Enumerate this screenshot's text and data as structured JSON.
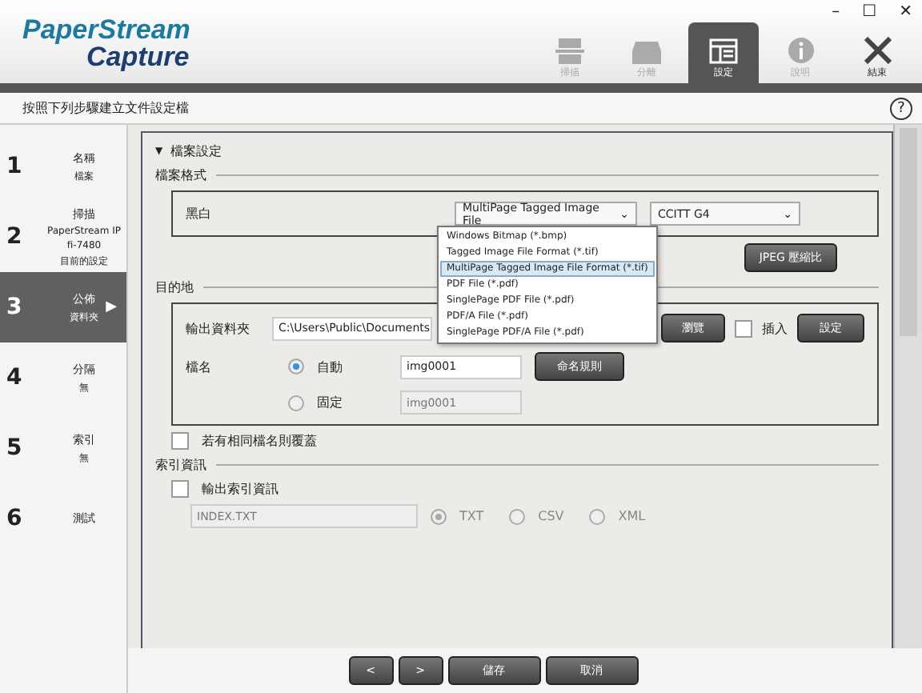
{
  "window_controls": [
    "–",
    "☐",
    "✕"
  ],
  "product": {
    "line1": "PaperStream",
    "line2": "Capture"
  },
  "toolbar": [
    {
      "label": "掃描",
      "selected": false,
      "disabled": true,
      "kind": "scan"
    },
    {
      "label": "分離",
      "selected": false,
      "disabled": true,
      "kind": "tray"
    },
    {
      "label": "設定",
      "selected": true,
      "disabled": false,
      "kind": "settings"
    },
    {
      "label": "說明",
      "selected": false,
      "disabled": true,
      "kind": "info"
    },
    {
      "label": "結束",
      "selected": false,
      "disabled": false,
      "kind": "exit"
    }
  ],
  "instruction": "按照下列步驟建立文件設定檔",
  "help": "?",
  "steps": [
    {
      "number": "1",
      "title": "名稱",
      "lines": [
        "檔案"
      ],
      "selected": false
    },
    {
      "number": "2",
      "title": "掃描",
      "lines": [
        "PaperStream IP",
        "fi-7480",
        "目前的設定"
      ],
      "selected": false
    },
    {
      "number": "3",
      "title": "公佈",
      "lines": [
        "資料夾"
      ],
      "selected": true,
      "arrow": "▶"
    },
    {
      "number": "4",
      "title": "分隔",
      "lines": [
        "無"
      ],
      "selected": false
    },
    {
      "number": "5",
      "title": "索引",
      "lines": [
        "無"
      ],
      "selected": false
    },
    {
      "number": "6",
      "title": "測試",
      "selected": false
    }
  ],
  "section": {
    "caret": "▼",
    "title": "檔案設定"
  },
  "file_format": {
    "legend": "檔案格式",
    "color_mode": "黑白",
    "format": "MultiPage Tagged Image File",
    "format_caret": "⌄",
    "compression": "CCITT G4",
    "compression_caret": "⌄",
    "jpeg_button": "JPEG 壓縮比",
    "options": [
      {
        "label": "Windows Bitmap (*.bmp)",
        "selected": false
      },
      {
        "label": "Tagged Image File Format (*.tif)",
        "selected": false
      },
      {
        "label": "MultiPage Tagged Image File Format (*.tif)",
        "selected": true
      },
      {
        "label": "PDF File (*.pdf)",
        "selected": false
      },
      {
        "label": "SinglePage PDF File (*.pdf)",
        "selected": false
      },
      {
        "label": "PDF/A File (*.pdf)",
        "selected": false
      },
      {
        "label": "SinglePage PDF/A File (*.pdf)",
        "selected": false
      }
    ]
  },
  "destination": {
    "legend": "目的地",
    "folder_label": "輸出資料夾",
    "folder": "C:\\Users\\Public\\Documents",
    "browse": "瀏覽",
    "append_label": "插入",
    "append": false,
    "settings_button": "設定",
    "name_label": "檔名",
    "naming_button": "命名規則",
    "name_modes": [
      {
        "label": "自動",
        "selected": true,
        "value": "img0001"
      },
      {
        "label": "固定",
        "selected": false,
        "value": "img0001"
      }
    ],
    "overwrite_label": "若有相同檔名則覆蓋",
    "overwrite": false
  },
  "index": {
    "legend": "索引資訊",
    "output_label": "輸出索引資訊",
    "output": false,
    "file": "INDEX.TXT",
    "types": [
      {
        "label": "TXT",
        "selected": true
      },
      {
        "label": "CSV",
        "selected": false
      },
      {
        "label": "XML",
        "selected": false
      }
    ]
  },
  "footer": [
    "<",
    ">",
    "儲存",
    "取消"
  ]
}
